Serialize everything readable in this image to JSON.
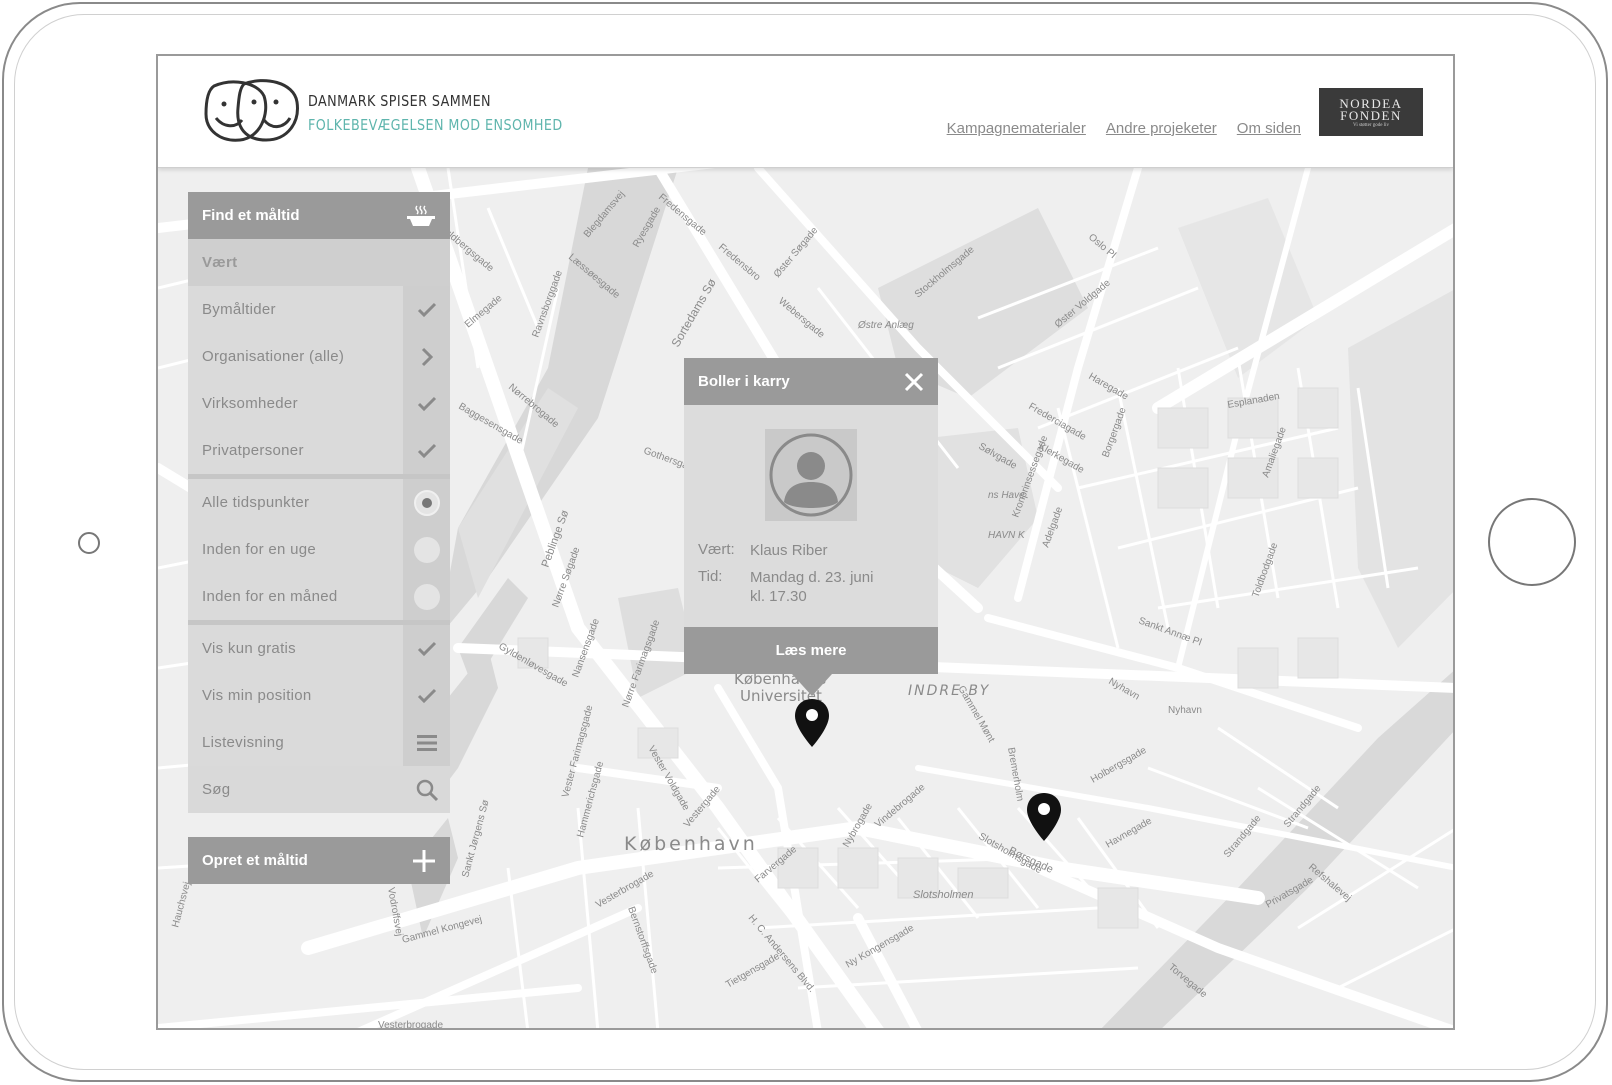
{
  "header": {
    "brand_line1": "DANMARK SPISER SAMMEN",
    "brand_line2": "FOLKEBEVÆGELSEN MOD ENSOMHED",
    "nav": [
      "Kampagnematerialer",
      "Andre projeketer",
      "Om siden"
    ],
    "sponsor_line1": "NORDEA",
    "sponsor_line2": "FONDEN",
    "sponsor_tagline": "Vi støtter gode liv"
  },
  "panel": {
    "title": "Find et måltid",
    "host_label": "Vært",
    "host_options": [
      {
        "label": "Bymåltider",
        "icon": "check-icon"
      },
      {
        "label": "Organisationer (alle)",
        "icon": "chevron-right-icon"
      },
      {
        "label": "Virksomheder",
        "icon": "check-icon"
      },
      {
        "label": "Privatpersoner",
        "icon": "check-icon"
      }
    ],
    "time_options": [
      {
        "label": "Alle tidspunkter",
        "selected": true
      },
      {
        "label": "Inden for en uge",
        "selected": false
      },
      {
        "label": "Inden for en måned",
        "selected": false
      }
    ],
    "view_options": [
      {
        "label": "Vis kun gratis",
        "icon": "check-icon"
      },
      {
        "label": "Vis min position",
        "icon": "check-icon"
      },
      {
        "label": "Listevisning",
        "icon": "list-icon"
      }
    ],
    "search_placeholder": "Søg",
    "create_label": "Opret et måltid"
  },
  "popup": {
    "title": "Boller i karry",
    "host_key": "Vært:",
    "host_value": "Klaus Riber",
    "time_key": "Tid:",
    "time_value_1": "Mandag d. 23. juni",
    "time_value_2": "kl. 17.30",
    "button": "Læs mere"
  },
  "map_labels": {
    "city": "København",
    "district": "INDRE BY",
    "university_1": "Københavns",
    "university_2": "Universitet",
    "streets": [
      "Fredensgade",
      "Blegdamsvej",
      "Fredensbro",
      "Øster Søgade",
      "Webersgade",
      "Stockholmsgade",
      "Øster Voldgade",
      "Oslo Pl",
      "Østre Anlæg",
      "Sortedams Sø",
      "Ryesgade",
      "Læssøesgade",
      "Guldbergsgade",
      "Elmegade",
      "Ravnsborggade",
      "Nørrebrogade",
      "Baggesensgade",
      "Gothersgade",
      "Pebinge Sø",
      "Nørre Søgade",
      "Gyldenløvesgade",
      "Nansensgade",
      "Nørre Farimagsgade",
      "Haregade",
      "Esplanaden",
      "Fredericiagade",
      "Borgergade",
      "Klerkegade",
      "Sølvgade",
      "Kronprinsessegade",
      "Adelgade",
      "Amaliegade",
      "Toldbodgade",
      "Sankt Annæ Pl",
      "Nyhavn",
      "Holbergsgade",
      "Havnegade",
      "Strandgade",
      "Børsgade",
      "Slotsholmen",
      "Vestergade",
      "Vester Voldgade",
      "Farvergade",
      "Nybrogade",
      "Vesterbrogade",
      "Gammel Kongevej",
      "Hammerichsgade",
      "Vester Farimagsgade",
      "Sankt Jørgens Sø",
      "Bernstorffsgade",
      "H. C. Andersens Blvd.",
      "Ny Kongensgade",
      "Tietgensgade",
      "Torvegade",
      "Refshalevej",
      "Christianshavn",
      "Vodroffsvej",
      "Gammel Mønt",
      "Bremerholm",
      "Slotsholmsgade",
      "Hauchsvej"
    ]
  },
  "colors": {
    "panel_header": "#9a9a9a",
    "panel_row": "#dadada",
    "brand_teal": "#5fb5ad",
    "sponsor_bg": "#3a3a3a"
  }
}
